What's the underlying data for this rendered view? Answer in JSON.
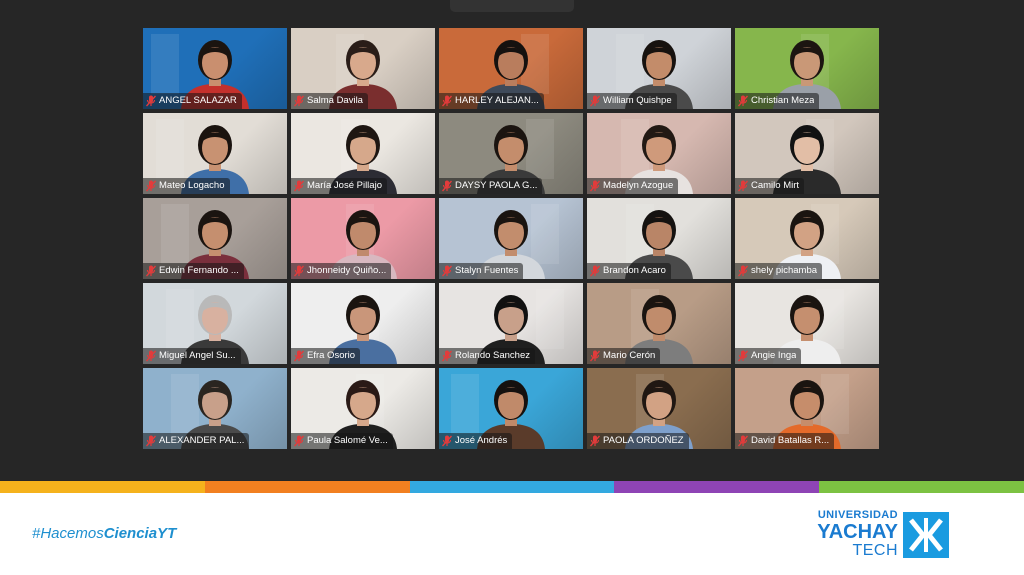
{
  "meeting": {
    "participants": [
      {
        "name": "ANGEL SALAZAR",
        "bg": "#1f6fb8",
        "skin": "#c98f6f",
        "hair": "#1b1410",
        "shirt": "#c4302c",
        "muted": true
      },
      {
        "name": "Salma Davila",
        "bg": "#d9cfc4",
        "skin": "#d8a98c",
        "hair": "#2a1d18",
        "shirt": "#7a2e2e",
        "muted": true
      },
      {
        "name": "HARLEY ALEJAN...",
        "bg": "#c96a3a",
        "skin": "#b97d5d",
        "hair": "#15110f",
        "shirt": "#3e4a5a",
        "muted": true
      },
      {
        "name": "William Quishpe",
        "bg": "#cfd3d8",
        "skin": "#c38c6a",
        "hair": "#17120f",
        "shirt": "#4a4a4a",
        "muted": true
      },
      {
        "name": "Christian Meza",
        "bg": "#86b64c",
        "skin": "#c99877",
        "hair": "#1c1511",
        "shirt": "#9aa0a8",
        "muted": true
      },
      {
        "name": "Mateo Logacho",
        "bg": "#e2ddd6",
        "skin": "#c89272",
        "hair": "#1a130f",
        "shirt": "#3f6fa8",
        "muted": true
      },
      {
        "name": "María José Pillajo",
        "bg": "#ebe7e1",
        "skin": "#d6a88b",
        "hair": "#1e1612",
        "shirt": "#2c2c34",
        "muted": true
      },
      {
        "name": "DAYSY PAOLA G...",
        "bg": "#8d8a7f",
        "skin": "#c48d6c",
        "hair": "#1b1410",
        "shirt": "#3a3a3a",
        "muted": true
      },
      {
        "name": "Madelyn Azogue",
        "bg": "#d6b8b0",
        "skin": "#cf9a7b",
        "hair": "#221914",
        "shirt": "#e7e2e0",
        "muted": true
      },
      {
        "name": "Camilo Mirt",
        "bg": "#d2c7bd",
        "skin": "#e2bea6",
        "hair": "#121212",
        "shirt": "#2a2a2a",
        "muted": true
      },
      {
        "name": "Edwin Fernando ...",
        "bg": "#a89f99",
        "skin": "#c58f6f",
        "hair": "#1b1410",
        "shirt": "#7a2f3c",
        "muted": true
      },
      {
        "name": "Jhonneidy Quiño...",
        "bg": "#ec9aa6",
        "skin": "#c08a6c",
        "hair": "#1b1410",
        "shirt": "#d8b8c0",
        "muted": true
      },
      {
        "name": "Stalyn Fuentes",
        "bg": "#b6c3d3",
        "skin": "#c28d6d",
        "hair": "#1a1410",
        "shirt": "#d3d7dc",
        "muted": true
      },
      {
        "name": "Brandon Acaro",
        "bg": "#e2e0dc",
        "skin": "#b98567",
        "hair": "#151210",
        "shirt": "#4a4a4a",
        "muted": true
      },
      {
        "name": "shely pichamba",
        "bg": "#d6c9b9",
        "skin": "#d2a284",
        "hair": "#1a1410",
        "shirt": "#eef0f4",
        "muted": true
      },
      {
        "name": "Miguel Angel Su...",
        "bg": "#d2d8dc",
        "skin": "#d8b1a0",
        "hair": "#b9b9b9",
        "shirt": "#3a3a3a",
        "muted": true
      },
      {
        "name": "Efra Osorio",
        "bg": "#eeeeee",
        "skin": "#c9967a",
        "hair": "#1a1410",
        "shirt": "#4a6fa0",
        "muted": true
      },
      {
        "name": "Rolando Sanchez",
        "bg": "#e7e4e2",
        "skin": "#c8a08a",
        "hair": "#111111",
        "shirt": "#1f1f1f",
        "muted": true
      },
      {
        "name": "Mario Cerón",
        "bg": "#b89c86",
        "skin": "#c08c6c",
        "hair": "#1a1410",
        "shirt": "#7d7d7d",
        "muted": true
      },
      {
        "name": "Angie Inga",
        "bg": "#e8e5e1",
        "skin": "#c58f6f",
        "hair": "#1a1410",
        "shirt": "#eeeeee",
        "muted": true
      },
      {
        "name": "ALEXANDER PAL...",
        "bg": "#8fb1cc",
        "skin": "#c8a08a",
        "hair": "#2a2520",
        "shirt": "#4a4a4a",
        "muted": true
      },
      {
        "name": "Paula Salomé Ve...",
        "bg": "#eceae6",
        "skin": "#d6a88b",
        "hair": "#2a1a16",
        "shirt": "#1f1f1f",
        "muted": true
      },
      {
        "name": "José Andrés",
        "bg": "#3aa6d8",
        "skin": "#c08a6a",
        "hair": "#15110f",
        "shirt": "#5a3b2a",
        "muted": true
      },
      {
        "name": "PAOLA ORDOÑEZ",
        "bg": "#8a6d4f",
        "skin": "#d2a284",
        "hair": "#201712",
        "shirt": "#7ea0cc",
        "muted": true
      },
      {
        "name": "David Batallas R...",
        "bg": "#c4a08a",
        "skin": "#c68d6b",
        "hair": "#1a1410",
        "shirt": "#e46a2a",
        "muted": true
      }
    ]
  },
  "branding": {
    "hashtag_prefix": "#Hacemos",
    "hashtag_bold": "CienciaYT",
    "logo_line1": "UNIVERSIDAD",
    "logo_line2": "YACHAY",
    "logo_line3": "TECH",
    "accent_color": "#1a7bd0",
    "stripe_colors": [
      "#f5b21c",
      "#f28020",
      "#33a9e0",
      "#8e44b5",
      "#7cc242"
    ]
  }
}
